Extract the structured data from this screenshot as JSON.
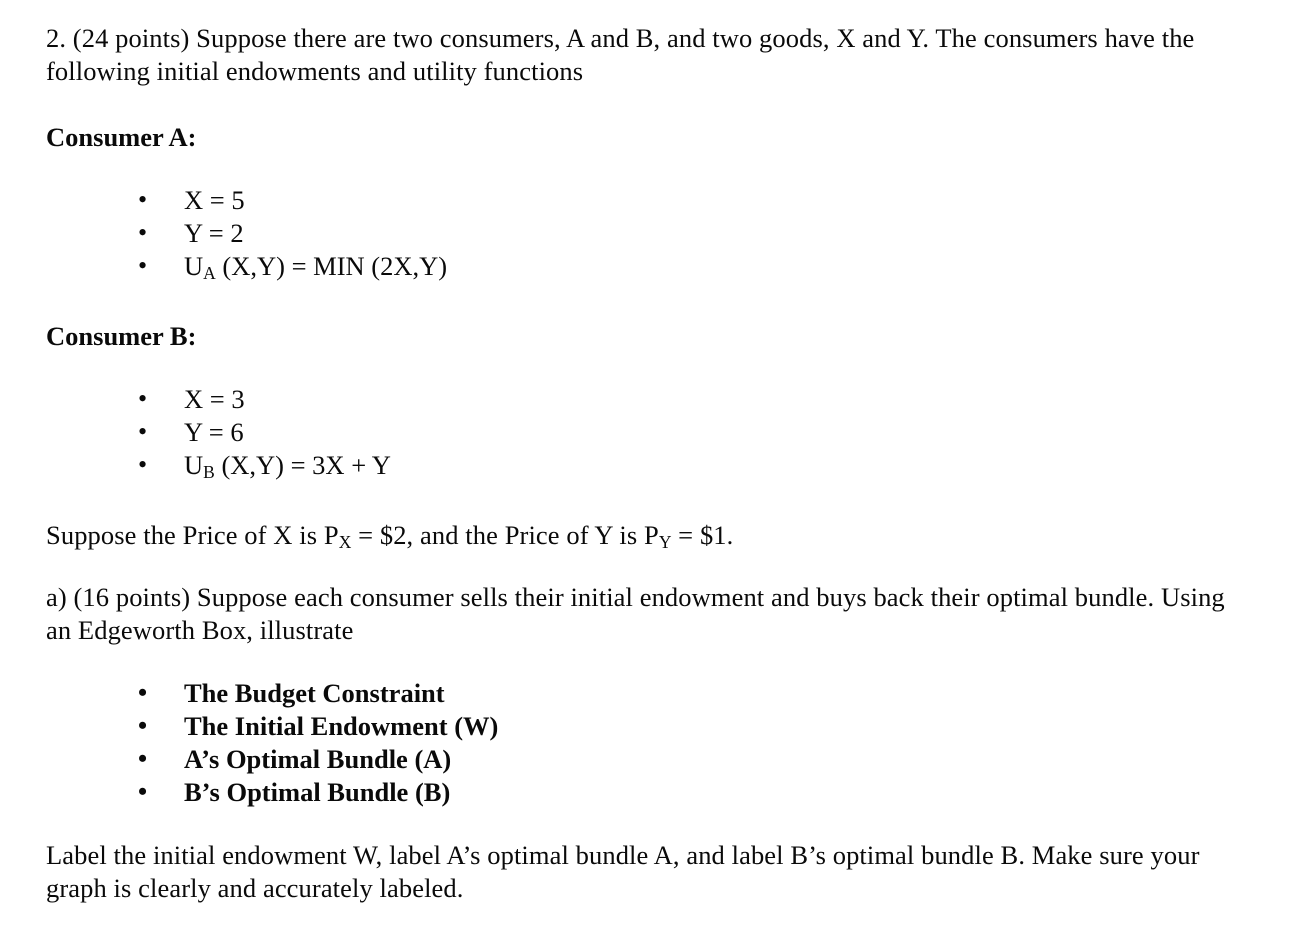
{
  "document": {
    "question_number": "2.",
    "points": "(24 points)",
    "intro_line1": "2.  (24 points) Suppose there are two consumers, A and B, and two goods, X and Y.  The consumers have",
    "intro_line2": "the following initial endowments and utility functions",
    "consumer_a": {
      "heading": "Consumer A:",
      "bullets": [
        {
          "text": "X = 5"
        },
        {
          "text": "Y = 2"
        },
        {
          "prefix": "U",
          "subscript": "A",
          "suffix": " (X,Y) = MIN (2X,Y)"
        }
      ]
    },
    "consumer_b": {
      "heading": "Consumer B:",
      "bullets": [
        {
          "text": "X = 3"
        },
        {
          "text": "Y = 6"
        },
        {
          "prefix": "U",
          "subscript": "B",
          "suffix": " (X,Y) = 3X + Y"
        }
      ]
    },
    "prices": {
      "lead": "Suppose the Price of X is P",
      "px_sub": "X",
      "mid": " = $2, and the Price of Y is P",
      "py_sub": "Y",
      "tail": " = $1."
    },
    "part_a": {
      "line1": "a) (16 points) Suppose each consumer sells their initial endowment and buys back their optimal bundle.",
      "line2": "Using an Edgeworth Box, illustrate",
      "requirements": [
        "The Budget Constraint",
        "The Initial Endowment (W)",
        "A’s Optimal Bundle (A)",
        "B’s Optimal Bundle (B)"
      ]
    },
    "closing": {
      "line1": "Label the initial endowment W, label A’s optimal bundle A, and label B’s optimal bundle B.  Make sure",
      "line2": "your graph is clearly and accurately labeled."
    }
  }
}
